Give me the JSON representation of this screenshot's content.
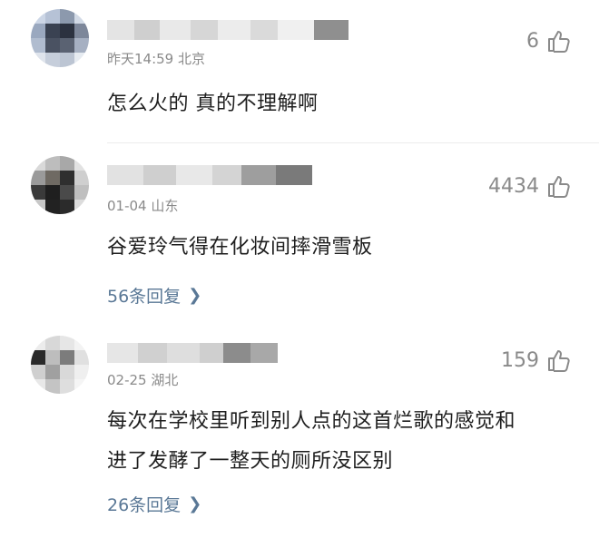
{
  "comments": [
    {
      "meta": "昨天14:59 北京",
      "text_lines": [
        "怎么火的  真的不理解啊"
      ],
      "likes": "6",
      "replies": ""
    },
    {
      "meta": "01-04 山东",
      "text_lines": [
        "谷爱玲气得在化妆间摔滑雪板"
      ],
      "likes": "4434",
      "replies": "56条回复"
    },
    {
      "meta": "02-25 湖北",
      "text_lines": [
        "每次在学校里听到别人点的这首烂歌的感觉和",
        "进了发酵了一整天的厕所没区别"
      ],
      "likes": "159",
      "replies": "26条回复"
    }
  ],
  "icons": {
    "like": "thumbs-up-icon",
    "chevron": "chevron-right-icon"
  },
  "colors": {
    "meta": "#8a8a8a",
    "reply_link": "#5a7896",
    "text": "#1e1e1e"
  }
}
